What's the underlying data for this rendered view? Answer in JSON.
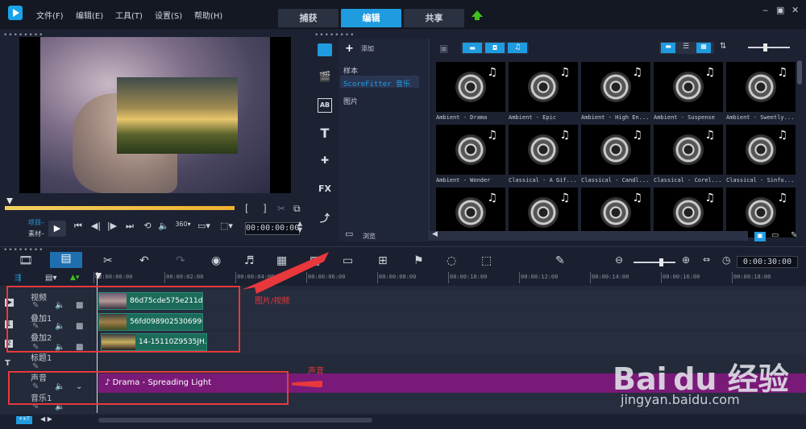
{
  "menu": {
    "items": [
      "文件(F)",
      "编辑(E)",
      "工具(T)",
      "设置(S)",
      "帮助(H)"
    ]
  },
  "tabs": [
    "捕获",
    "编辑",
    "共享"
  ],
  "window": {
    "min": "‒",
    "restore": "▣",
    "close": "✕"
  },
  "player": {
    "labels": {
      "project": "项目–",
      "clip": "素材–"
    },
    "timecode": "00:00:00:00"
  },
  "library": {
    "add_label": "添加",
    "browse_label": "浏览",
    "folders": [
      "样本",
      "ScoreFitter 音乐",
      "图片"
    ],
    "items": [
      "Ambient - Drama",
      "Ambient - Epic",
      "Ambient - High En...",
      "Ambient - Suspense",
      "Ambient - Sweetly...",
      "Ambient - Wonder",
      "Classical - A Gif...",
      "Classical - Candl...",
      "Classical - Corel...",
      "Classical - Sinfo...",
      "",
      "",
      "",
      "",
      ""
    ]
  },
  "timeline": {
    "timecode": "0:00:30:00",
    "ruler": [
      "00:00:00:00",
      "00:00:02:00",
      "00:00:04:00",
      "00:00:06:00",
      "00:00:08:00",
      "00:00:10:00",
      "00:00:12:00",
      "00:00:14:00",
      "00:00:16:00",
      "00:00:18:00"
    ],
    "tracks": {
      "video": "视频",
      "overlay1": "叠加1",
      "overlay2": "叠加2",
      "title1": "标题1",
      "voice": "声音",
      "music1": "音乐1"
    },
    "clips": {
      "video": "86d75cde575e211d5",
      "overlay1": "56fd09890253069969",
      "overlay2": "14-15110Z9535JH.jp",
      "audio": "Drama - Spreading Light"
    }
  },
  "annotations": {
    "image_video": "图片/视频",
    "sound": "声音"
  },
  "watermark": {
    "logo": "Bai du 经验",
    "url": "jingyan.baidu.com"
  }
}
